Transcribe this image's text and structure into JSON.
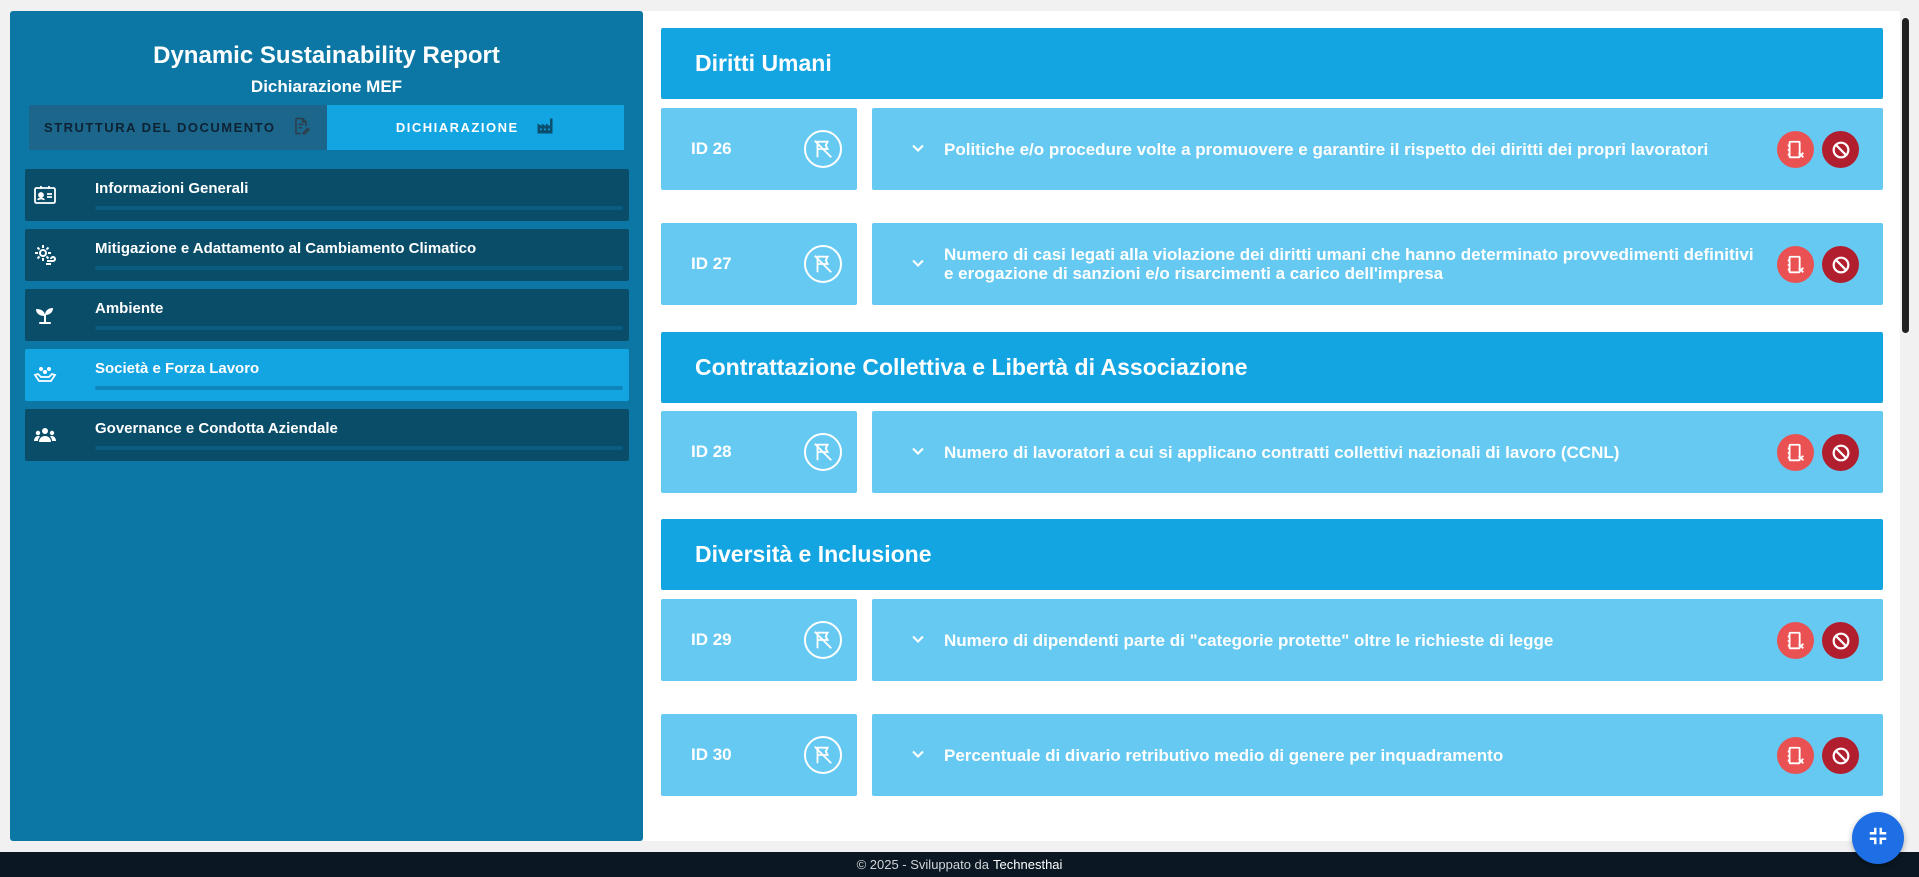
{
  "app": {
    "title": "Dynamic Sustainability Report",
    "subtitle": "Dichiarazione MEF"
  },
  "tabs": [
    {
      "label": "STRUTTURA DEL DOCUMENTO",
      "icon": "document-edit-icon",
      "active": false
    },
    {
      "label": "DICHIARAZIONE",
      "icon": "factory-icon",
      "active": true
    }
  ],
  "sidebar": {
    "items": [
      {
        "label": "Informazioni Generali",
        "icon": "id-card-icon",
        "active": false
      },
      {
        "label": "Mitigazione e Adattamento al Cambiamento Climatico",
        "icon": "sun-wind-icon",
        "active": false
      },
      {
        "label": "Ambiente",
        "icon": "seedling-icon",
        "active": false
      },
      {
        "label": "Società e Forza Lavoro",
        "icon": "hands-people-icon",
        "active": true
      },
      {
        "label": "Governance e Condotta Aziendale",
        "icon": "people-group-icon",
        "active": false
      }
    ]
  },
  "sections": [
    {
      "title": "Diritti Umani",
      "items": [
        {
          "id": "ID 26",
          "text": "Politiche e/o procedure volte a promuovere e garantire il rispetto dei diritti dei propri lavoratori"
        },
        {
          "id": "ID 27",
          "text": "Numero di casi legati alla violazione dei diritti umani che hanno determinato provvedimenti definitivi e erogazione di sanzioni e/o risarcimenti a carico dell'impresa"
        }
      ]
    },
    {
      "title": "Contrattazione Collettiva e Libertà di Associazione",
      "items": [
        {
          "id": "ID 28",
          "text": "Numero di lavoratori a cui si applicano contratti collettivi nazionali di lavoro (CCNL)"
        }
      ]
    },
    {
      "title": "Diversità e Inclusione",
      "items": [
        {
          "id": "ID 29",
          "text": "Numero di dipendenti parte di \"categorie protette\" oltre le richieste di legge"
        },
        {
          "id": "ID 30",
          "text": "Percentuale di divario retributivo medio di genere per inquadramento"
        }
      ]
    }
  ],
  "footer": {
    "text": "© 2025 - Sviluppato da",
    "brand": "Technesthai"
  },
  "colors": {
    "sidebar_bg": "#0c77a4",
    "accent": "#13a4e2",
    "row_bg": "#66c9f1",
    "danger_light": "#e95153",
    "danger_dark": "#b11e2e",
    "fab": "#1e6fe6"
  }
}
